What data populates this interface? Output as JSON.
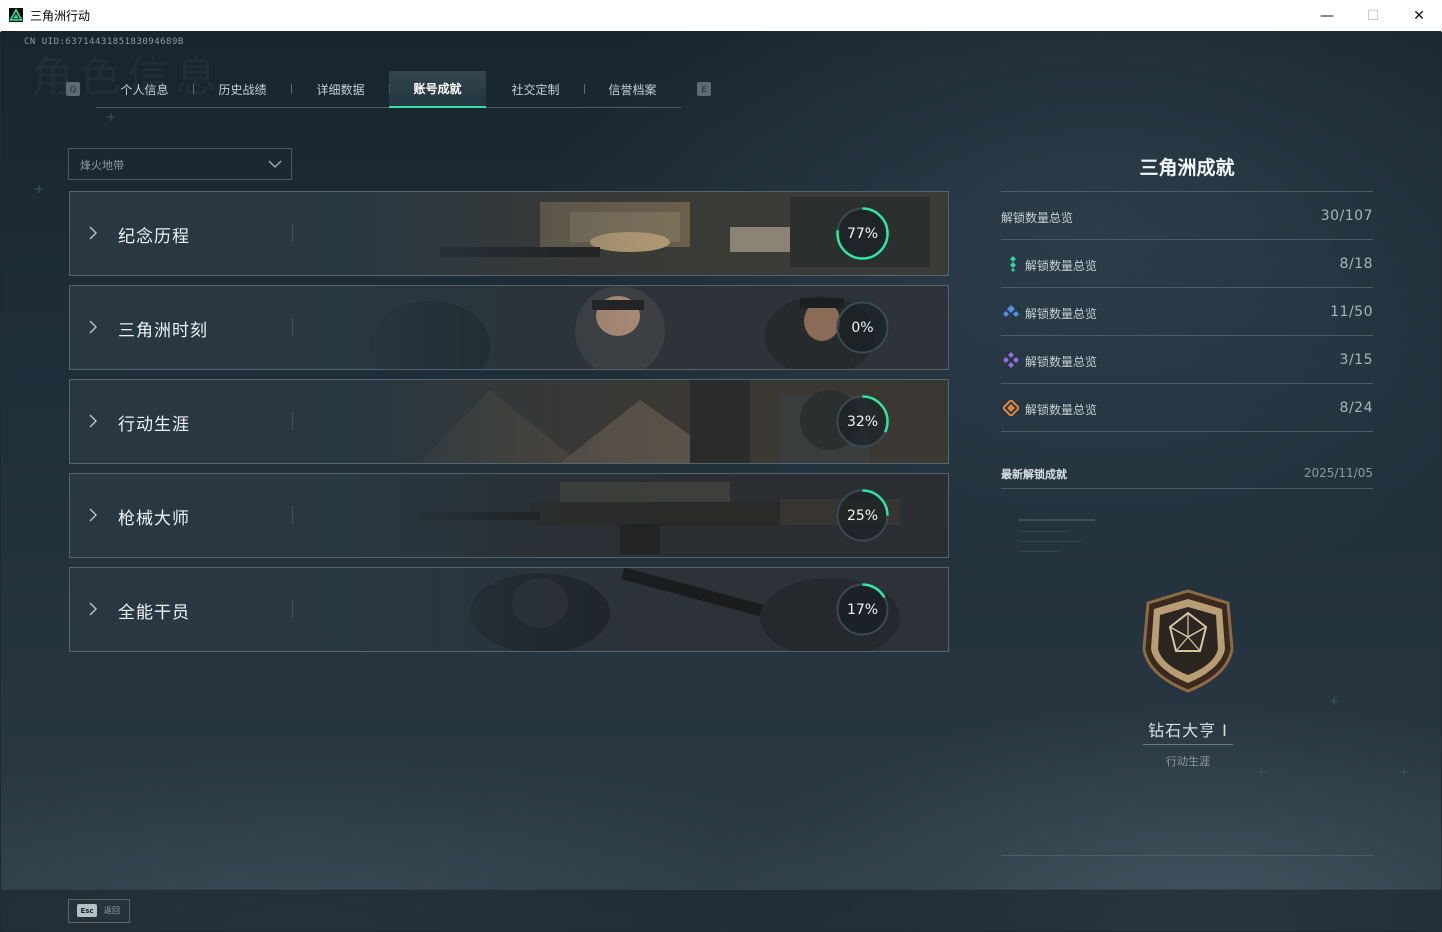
{
  "window": {
    "title": "三角洲行动",
    "minimize": "—",
    "maximize": "☐",
    "close": "✕"
  },
  "header": {
    "uid": "CN UID:6371443185183094689B",
    "ghost_title": "角色信息"
  },
  "tabs": {
    "prev_key": "Q",
    "next_key": "E",
    "items": [
      {
        "label": "个人信息",
        "active": false
      },
      {
        "label": "历史战绩",
        "active": false
      },
      {
        "label": "详细数据",
        "active": false
      },
      {
        "label": "账号成就",
        "active": true
      },
      {
        "label": "社交定制",
        "active": false
      },
      {
        "label": "信誉档案",
        "active": false
      }
    ]
  },
  "mode_dropdown": {
    "selected": "烽火地带"
  },
  "categories": [
    {
      "name": "纪念历程",
      "progress": "77%",
      "value": 0.77
    },
    {
      "name": "三角洲时刻",
      "progress": "0%",
      "value": 0.0
    },
    {
      "name": "行动生涯",
      "progress": "32%",
      "value": 0.32
    },
    {
      "name": "枪械大师",
      "progress": "25%",
      "value": 0.25
    },
    {
      "name": "全能干员",
      "progress": "17%",
      "value": 0.17
    }
  ],
  "summary": {
    "title": "三角洲成就",
    "total": {
      "label": "解锁数量总览",
      "value": "30/107"
    },
    "rows": [
      {
        "label": "解锁数量总览",
        "value": "8/18",
        "icon": "green-tier-icon",
        "color": "#2fd6a0"
      },
      {
        "label": "解锁数量总览",
        "value": "11/50",
        "icon": "blue-tier-icon",
        "color": "#4f8fe6"
      },
      {
        "label": "解锁数量总览",
        "value": "3/15",
        "icon": "purple-tier-icon",
        "color": "#9a6be0"
      },
      {
        "label": "解锁数量总览",
        "value": "8/24",
        "icon": "orange-tier-icon",
        "color": "#e0883a"
      }
    ]
  },
  "latest": {
    "label": "最新解锁成就",
    "date": "2025/11/05",
    "achievement_name": "钻石大亨 I",
    "achievement_category": "行动生涯",
    "icon": "diamond-shield-badge-icon"
  },
  "footer": {
    "esc_key": "Esc",
    "esc_label": "返回"
  },
  "colors": {
    "accent": "#2ee6a0",
    "ring_track": "#3b4a52"
  }
}
